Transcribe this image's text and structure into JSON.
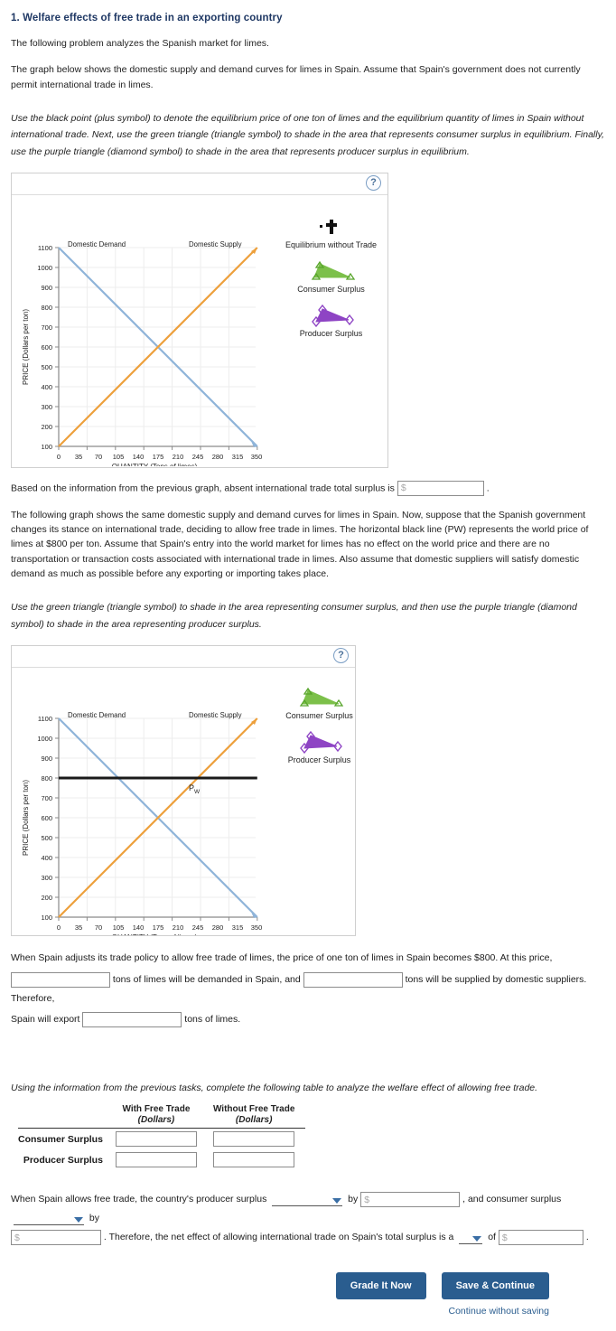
{
  "question": {
    "title": "1. Welfare effects of free trade in an exporting country",
    "intro": "The following problem analyzes the Spanish market for limes.",
    "para_graph1": "The graph below shows the domestic supply and demand curves for limes in Spain. Assume that Spain's government does not currently permit international trade in limes.",
    "instruction1": "Use the black point (plus symbol) to denote the equilibrium price of one ton of limes and the equilibrium quantity of limes in Spain without international trade. Next, use the green triangle (triangle symbol) to shade in the area that represents consumer surplus in equilibrium. Finally, use the purple triangle (diamond symbol) to shade in the area that represents producer surplus in equilibrium.",
    "surplus_prompt_before": "Based on the information from the previous graph, absent international trade total surplus is",
    "surplus_prompt_after": ".",
    "para_graph2": "The following graph shows the same domestic supply and demand curves for limes in Spain. Now, suppose that the Spanish government changes its stance on international trade, deciding to allow free trade in limes. The horizontal black line (PW) represents the world price of limes at $800 per ton. Assume that Spain's entry into the world market for limes has no effect on the world price and there are no transportation or transaction costs associated with international trade in limes. Also assume that domestic suppliers will satisfy domestic demand as much as possible before any exporting or importing takes place.",
    "instruction2": "Use the green triangle (triangle symbol) to shade in the area representing consumer surplus, and then use the purple triangle (diamond symbol) to shade in the area representing producer surplus.",
    "table_intro": "Using the information from the previous tasks, complete the following table to analyze the welfare effect of allowing free trade."
  },
  "quantity_questions": {
    "line1": "When Spain adjusts its trade policy to allow free trade of limes, the price of one ton of limes in Spain becomes $800. At this price,",
    "after_demanded": "tons of limes will be demanded in Spain, and",
    "after_supplied": "tons will be supplied by domestic suppliers. Therefore,",
    "export_prefix": "Spain will export",
    "export_suffix": "tons of limes."
  },
  "welfare_table": {
    "columns": [
      {
        "header": "With Free Trade",
        "sub": "(Dollars)"
      },
      {
        "header": "Without Free Trade",
        "sub": "(Dollars)"
      }
    ],
    "rows": [
      {
        "label": "Consumer Surplus",
        "values": [
          "",
          ""
        ]
      },
      {
        "label": "Producer Surplus",
        "values": [
          "",
          ""
        ]
      }
    ]
  },
  "conclusion": {
    "seg1": "When Spain allows free trade, the country's producer surplus",
    "seg2": "by",
    "seg3": ", and consumer surplus",
    "seg4": "by",
    "seg5": ". Therefore, the net effect of allowing international trade on Spain's total surplus is a",
    "seg6": "of",
    "seg7": "."
  },
  "inputs": {
    "dollar_placeholder": "$",
    "empty_value": ""
  },
  "footer": {
    "grade_label": "Grade It Now",
    "save_label": "Save & Continue",
    "continue_label": "Continue without saving"
  },
  "colors": {
    "title": "#1f3864",
    "demand": "#8fb4d9",
    "supply": "#eda03c",
    "world_price": "#1a1a1a",
    "consumer_surplus": "#7cc04a",
    "producer_surplus": "#8e44c4",
    "button": "#2a5d8f",
    "link": "#2a5d8f"
  },
  "chart_data": [
    {
      "type": "line",
      "id": "graph-no-trade",
      "title": "",
      "xlabel": "QUANTITY (Tons of limes)",
      "ylabel": "PRICE (Dollars per ton)",
      "xticks": [
        0,
        35,
        70,
        105,
        140,
        175,
        210,
        245,
        280,
        315,
        350
      ],
      "yticks": [
        100,
        200,
        300,
        400,
        500,
        600,
        700,
        800,
        900,
        1000,
        1100
      ],
      "xlim": [
        0,
        350
      ],
      "ylim": [
        100,
        1100
      ],
      "grid": true,
      "legend_position": "right",
      "series": [
        {
          "name": "Domestic Demand",
          "color": "#8fb4d9",
          "points": [
            [
              0,
              1100
            ],
            [
              350,
              100
            ]
          ]
        },
        {
          "name": "Domestic Supply",
          "color": "#eda03c",
          "points": [
            [
              0,
              100
            ],
            [
              350,
              1100
            ]
          ]
        }
      ],
      "annotations": [
        {
          "text": "Domestic Demand",
          "x": 35,
          "y": 1100
        },
        {
          "text": "Domestic Supply",
          "x": 245,
          "y": 1100
        }
      ],
      "equilibrium": {
        "quantity": 175,
        "price": 600
      },
      "legend": [
        {
          "label": "Equilibrium without Trade",
          "symbol": "plus-point",
          "color": "#1a1a1a"
        },
        {
          "label": "Consumer Surplus",
          "symbol": "triangle",
          "color": "#7cc04a"
        },
        {
          "label": "Producer Surplus",
          "symbol": "diamond-triangle",
          "color": "#8e44c4"
        }
      ]
    },
    {
      "type": "line",
      "id": "graph-free-trade",
      "title": "",
      "xlabel": "QUANTITY (Tons of limes)",
      "ylabel": "PRICE (Dollars per ton)",
      "xticks": [
        0,
        35,
        70,
        105,
        140,
        175,
        210,
        245,
        280,
        315,
        350
      ],
      "yticks": [
        100,
        200,
        300,
        400,
        500,
        600,
        700,
        800,
        900,
        1000,
        1100
      ],
      "xlim": [
        0,
        350
      ],
      "ylim": [
        100,
        1100
      ],
      "grid": true,
      "legend_position": "right",
      "series": [
        {
          "name": "Domestic Demand",
          "color": "#8fb4d9",
          "points": [
            [
              0,
              1100
            ],
            [
              350,
              100
            ]
          ]
        },
        {
          "name": "Domestic Supply",
          "color": "#eda03c",
          "points": [
            [
              0,
              100
            ],
            [
              350,
              1100
            ]
          ]
        },
        {
          "name": "PW",
          "color": "#1a1a1a",
          "points": [
            [
              0,
              800
            ],
            [
              350,
              800
            ]
          ]
        }
      ],
      "annotations": [
        {
          "text": "Domestic Demand",
          "x": 35,
          "y": 1100
        },
        {
          "text": "Domestic Supply",
          "x": 245,
          "y": 1100
        },
        {
          "text": "PW",
          "x": 190,
          "y": 760
        }
      ],
      "world_price": 800,
      "quantity_demanded_at_world_price": 105,
      "quantity_supplied_at_world_price": 245,
      "legend": [
        {
          "label": "Consumer Surplus",
          "symbol": "triangle",
          "color": "#7cc04a"
        },
        {
          "label": "Producer Surplus",
          "symbol": "diamond-triangle",
          "color": "#8e44c4"
        }
      ]
    }
  ],
  "axis_labels": {
    "x": "QUANTITY (Tons of limes)",
    "y": "PRICE (Dollars per ton)",
    "demand_label": "Domestic Demand",
    "supply_label": "Domestic Supply",
    "world_price_label_main": "P",
    "world_price_label_sub": "W"
  },
  "help_icon": "?"
}
